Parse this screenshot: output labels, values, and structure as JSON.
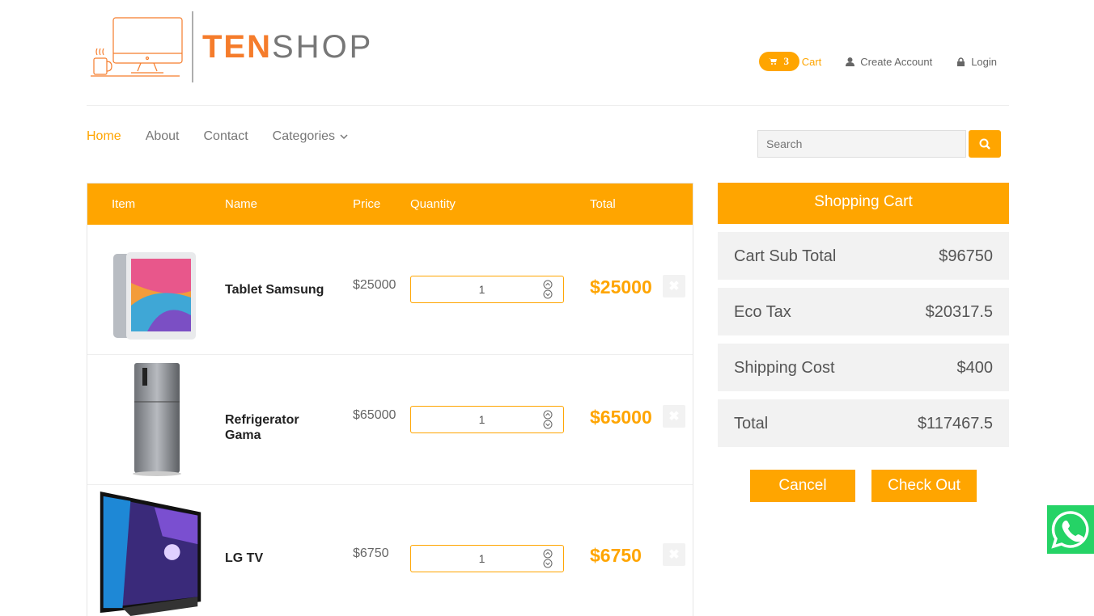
{
  "brand": {
    "ten": "TEN",
    "shop": "SHOP"
  },
  "top_links": {
    "cart_count": "3",
    "cart_label": "Cart",
    "create_account": "Create Account",
    "login": "Login"
  },
  "nav": {
    "home": "Home",
    "about": "About",
    "contact": "Contact",
    "categories": "Categories"
  },
  "search": {
    "placeholder": "Search"
  },
  "table": {
    "headers": {
      "item": "Item",
      "name": "Name",
      "price": "Price",
      "quantity": "Quantity",
      "total": "Total"
    },
    "rows": [
      {
        "name": "Tablet Samsung",
        "price": "$25000",
        "quantity": "1",
        "total": "$25000"
      },
      {
        "name": "Refrigerator Gama",
        "price": "$65000",
        "quantity": "1",
        "total": "$65000"
      },
      {
        "name": "LG TV",
        "price": "$6750",
        "quantity": "1",
        "total": "$6750"
      }
    ]
  },
  "summary": {
    "title": "Shopping Cart",
    "sub_total_label": "Cart Sub Total",
    "sub_total": "$96750",
    "eco_tax_label": "Eco Tax",
    "eco_tax": "$20317.5",
    "shipping_label": "Shipping Cost",
    "shipping": "$400",
    "total_label": "Total",
    "total": "$117467.5",
    "cancel": "Cancel",
    "checkout": "Check Out"
  },
  "colors": {
    "accent": "#ffa500",
    "brand_orange": "#f57c2b",
    "whatsapp": "#25d366"
  },
  "icons": [
    "cart-icon",
    "user-icon",
    "lock-icon",
    "chevron-down-icon",
    "search-icon",
    "remove-icon",
    "whatsapp-icon"
  ]
}
